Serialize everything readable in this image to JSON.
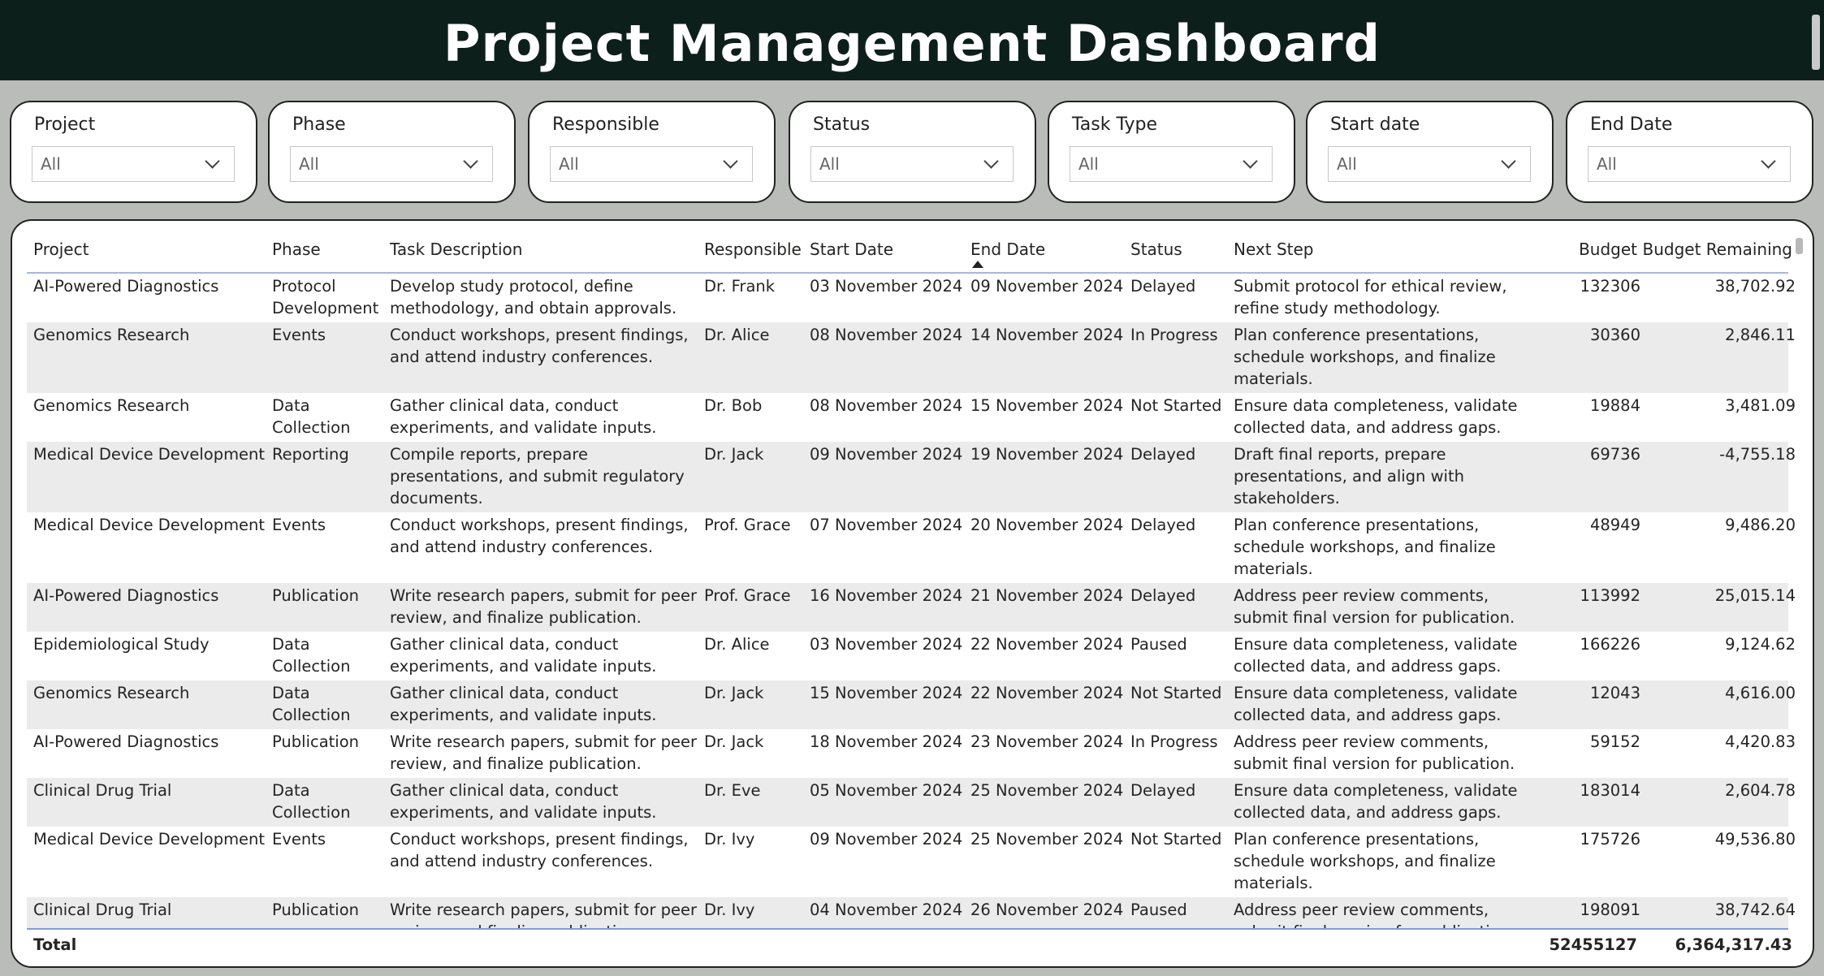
{
  "header": {
    "title": "Project Management Dashboard"
  },
  "slicers": [
    {
      "id": "project",
      "label": "Project",
      "value": "All"
    },
    {
      "id": "phase",
      "label": "Phase",
      "value": "All"
    },
    {
      "id": "responsible",
      "label": "Responsible",
      "value": "All"
    },
    {
      "id": "status",
      "label": "Status",
      "value": "All"
    },
    {
      "id": "task-type",
      "label": "Task Type",
      "value": "All"
    },
    {
      "id": "start-date",
      "label": "Start date",
      "value": "All"
    },
    {
      "id": "end-date",
      "label": "End Date",
      "value": "All"
    }
  ],
  "table": {
    "columns": [
      "Project",
      "Phase",
      "Task Description",
      "Responsible",
      "Start Date",
      "End Date",
      "Status",
      "Next Step",
      "Budget",
      "Budget Remaining"
    ],
    "sorted_column": "End Date",
    "sort_direction": "ascending",
    "rows": [
      [
        "AI-Powered Diagnostics",
        "Protocol\nDevelopment",
        "Develop study protocol, define\nmethodology, and obtain approvals.",
        "Dr. Frank",
        "03 November 2024",
        "09 November 2024",
        "Delayed",
        "Submit protocol for ethical review,\nrefine study methodology.",
        "132306",
        "38,702.92"
      ],
      [
        "Genomics Research",
        "Events",
        "Conduct workshops, present findings,\nand attend industry conferences.",
        "Dr. Alice",
        "08 November 2024",
        "14 November 2024",
        "In Progress",
        "Plan conference presentations,\nschedule workshops, and finalize\nmaterials.",
        "30360",
        "2,846.11"
      ],
      [
        "Genomics Research",
        "Data\nCollection",
        "Gather clinical data, conduct\nexperiments, and validate inputs.",
        "Dr. Bob",
        "08 November 2024",
        "15 November 2024",
        "Not Started",
        "Ensure data completeness, validate\ncollected data, and address gaps.",
        "19884",
        "3,481.09"
      ],
      [
        "Medical Device Development",
        "Reporting",
        "Compile reports, prepare\npresentations, and submit regulatory\ndocuments.",
        "Dr. Jack",
        "09 November 2024",
        "19 November 2024",
        "Delayed",
        "Draft final reports, prepare\npresentations, and align with\nstakeholders.",
        "69736",
        "-4,755.18"
      ],
      [
        "Medical Device Development",
        "Events",
        "Conduct workshops, present findings,\nand attend industry conferences.",
        "Prof. Grace",
        "07 November 2024",
        "20 November 2024",
        "Delayed",
        "Plan conference presentations,\nschedule workshops, and finalize\nmaterials.",
        "48949",
        "9,486.20"
      ],
      [
        "AI-Powered Diagnostics",
        "Publication",
        "Write research papers, submit for peer\nreview, and finalize publication.",
        "Prof. Grace",
        "16 November 2024",
        "21 November 2024",
        "Delayed",
        "Address peer review comments,\nsubmit final version for publication.",
        "113992",
        "25,015.14"
      ],
      [
        "Epidemiological Study",
        "Data\nCollection",
        "Gather clinical data, conduct\nexperiments, and validate inputs.",
        "Dr. Alice",
        "03 November 2024",
        "22 November 2024",
        "Paused",
        "Ensure data completeness, validate\ncollected data, and address gaps.",
        "166226",
        "9,124.62"
      ],
      [
        "Genomics Research",
        "Data\nCollection",
        "Gather clinical data, conduct\nexperiments, and validate inputs.",
        "Dr. Jack",
        "15 November 2024",
        "22 November 2024",
        "Not Started",
        "Ensure data completeness, validate\ncollected data, and address gaps.",
        "12043",
        "4,616.00"
      ],
      [
        "AI-Powered Diagnostics",
        "Publication",
        "Write research papers, submit for peer\nreview, and finalize publication.",
        "Dr. Jack",
        "18 November 2024",
        "23 November 2024",
        "In Progress",
        "Address peer review comments,\nsubmit final version for publication.",
        "59152",
        "4,420.83"
      ],
      [
        "Clinical Drug Trial",
        "Data\nCollection",
        "Gather clinical data, conduct\nexperiments, and validate inputs.",
        "Dr. Eve",
        "05 November 2024",
        "25 November 2024",
        "Delayed",
        "Ensure data completeness, validate\ncollected data, and address gaps.",
        "183014",
        "2,604.78"
      ],
      [
        "Medical Device Development",
        "Events",
        "Conduct workshops, present findings,\nand attend industry conferences.",
        "Dr. Ivy",
        "09 November 2024",
        "25 November 2024",
        "Not Started",
        "Plan conference presentations,\nschedule workshops, and finalize\nmaterials.",
        "175726",
        "49,536.80"
      ],
      [
        "Clinical Drug Trial",
        "Publication",
        "Write research papers, submit for peer\nreview, and finalize publication.",
        "Dr. Ivy",
        "04 November 2024",
        "26 November 2024",
        "Paused",
        "Address peer review comments,\nsubmit final version for publication.",
        "198091",
        "38,742.64"
      ]
    ],
    "total": {
      "label": "Total",
      "budget": "52455127",
      "budget_remaining": "6,364,317.43"
    }
  }
}
